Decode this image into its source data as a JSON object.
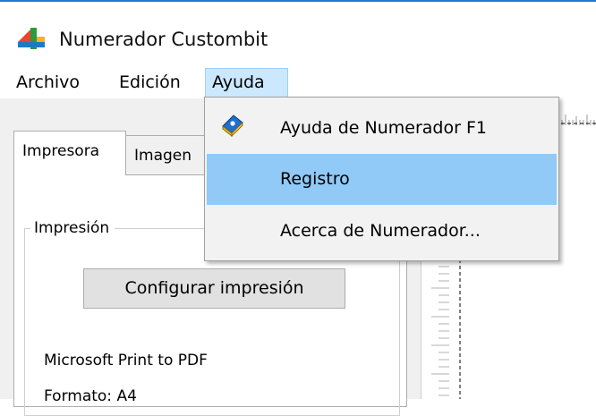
{
  "window": {
    "title": "Numerador Custombit",
    "icon": "app-logo-icon"
  },
  "menubar": {
    "items": [
      {
        "label": "Archivo"
      },
      {
        "label": "Edición"
      },
      {
        "label": "Ayuda",
        "active": true
      }
    ]
  },
  "tabs": [
    {
      "label": "Impresora",
      "selected": true
    },
    {
      "label": "Imagen"
    }
  ],
  "print_group": {
    "label": "Impresión",
    "config_button": "Configurar impresión",
    "printer_name": "Microsoft Print to PDF",
    "format": "Formato: A4"
  },
  "help_menu": {
    "items": [
      {
        "label": "Ayuda de Numerador F1",
        "icon": "help-book-icon"
      },
      {
        "label": "Registro",
        "highlighted": true
      },
      {
        "label": "Acerca de Numerador..."
      }
    ]
  },
  "colors": {
    "menu_active_bg": "#cce8ff",
    "menu_highlight": "#91c9f7",
    "window_border": "#1e78d6"
  }
}
